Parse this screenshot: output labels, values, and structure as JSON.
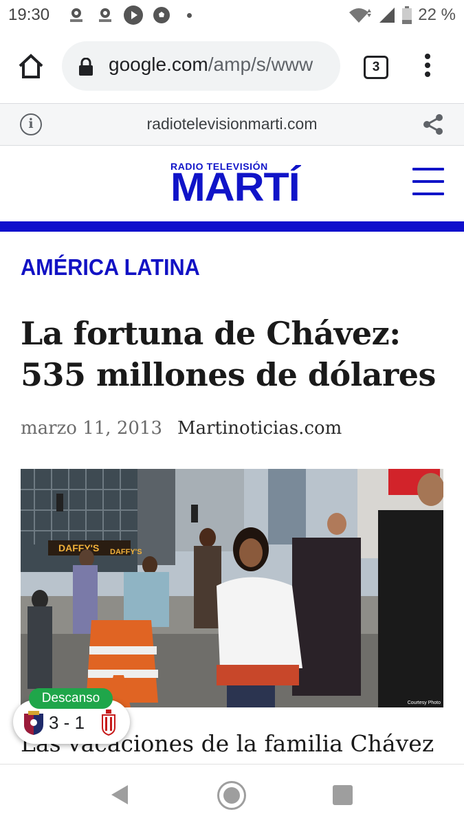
{
  "status_bar": {
    "time": "19:30",
    "notification_icons": [
      "laliga-icon",
      "laliga-icon",
      "play-icon",
      "soccer-ball-icon",
      "dot-icon"
    ],
    "battery": "22 %"
  },
  "browser": {
    "url_domain": "google.com",
    "url_path": "/amp/s/www",
    "tab_count": "3"
  },
  "amp_header": {
    "domain": "radiotelevisionmarti.com"
  },
  "site": {
    "logo_top": "RADIO TELEVISIÓN",
    "logo_main": "MARTÍ",
    "brand_color": "#1010cc"
  },
  "article": {
    "category": "AMÉRICA LATINA",
    "headline": "La fortuna de Chávez: 535 millones de dólares",
    "date": "marzo 11, 2013",
    "source": "Martinoticias.com",
    "photo_credit": "Courtesy Photo",
    "store_signs": [
      "DAFFY'S",
      "DAFFY'S"
    ],
    "caption": "Las vacaciones de la familia Chávez"
  },
  "score_widget": {
    "status": "Descanso",
    "score": "3 - 1",
    "status_color": "#1fa64a"
  }
}
